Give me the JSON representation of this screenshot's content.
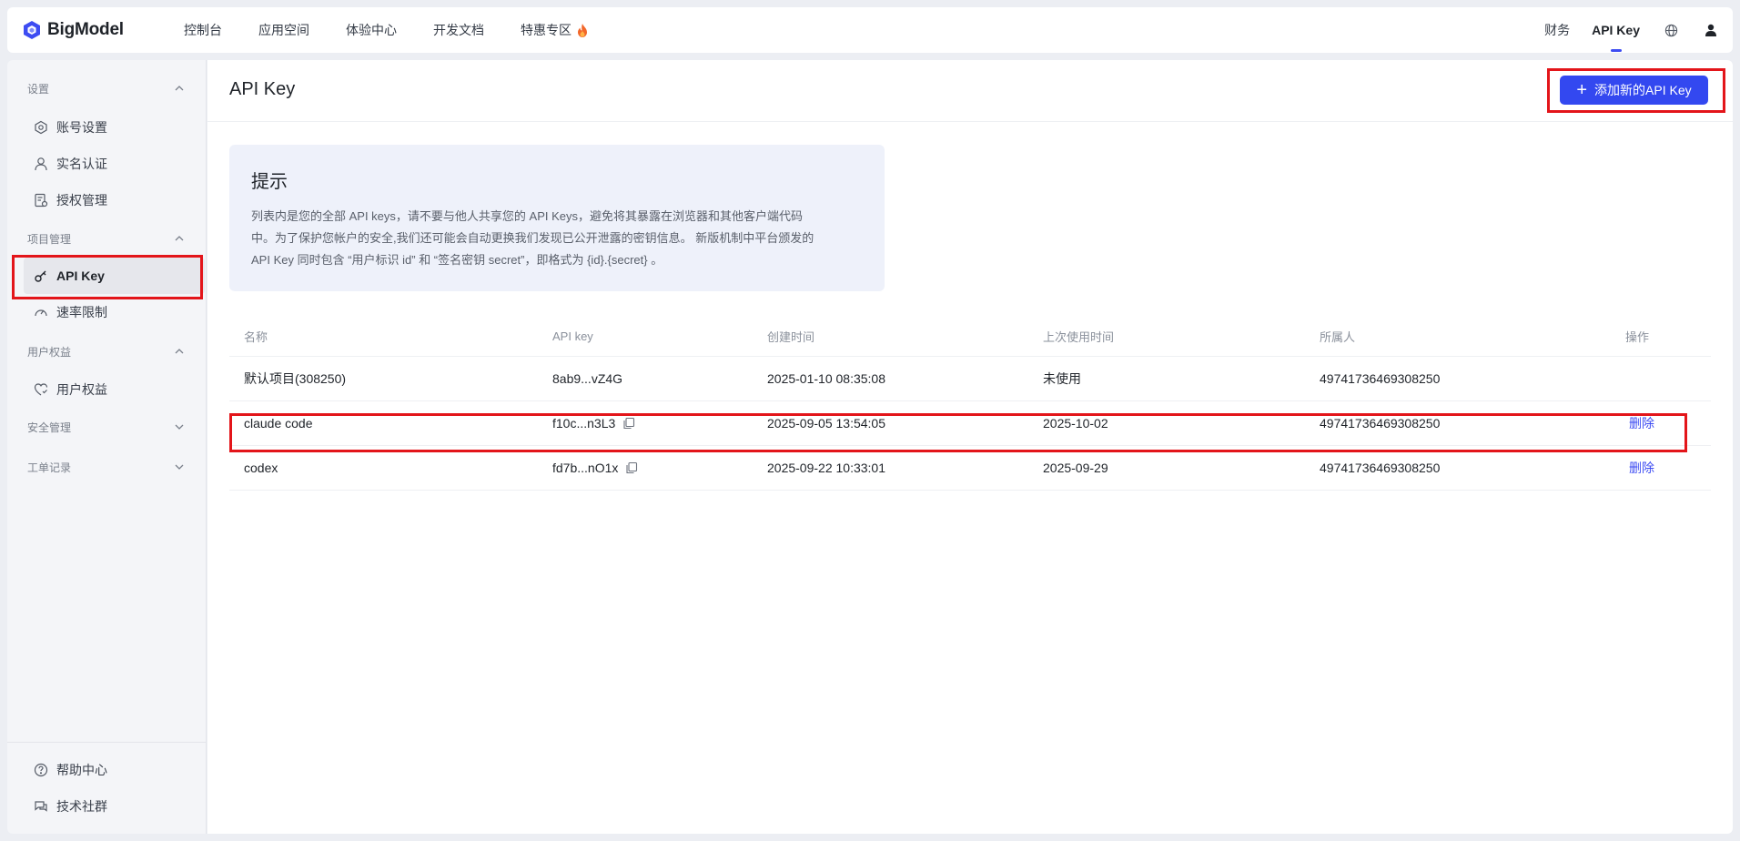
{
  "brand": {
    "name": "BigModel"
  },
  "nav": {
    "items": [
      "控制台",
      "应用空间",
      "体验中心",
      "开发文档",
      "特惠专区"
    ],
    "right": {
      "finance": "财务",
      "api_key": "API Key"
    }
  },
  "sidebar": {
    "groups": {
      "settings": "设置",
      "project": "项目管理",
      "rights": "用户权益",
      "security": "安全管理",
      "tickets": "工单记录"
    },
    "items": {
      "account": "账号设置",
      "realname": "实名认证",
      "auth": "授权管理",
      "apikey": "API Key",
      "ratelimit": "速率限制",
      "userrights": "用户权益",
      "help": "帮助中心",
      "community": "技术社群"
    }
  },
  "main": {
    "title": "API Key",
    "add_button": "添加新的API Key",
    "tip": {
      "title": "提示",
      "line1": "列表内是您的全部 API keys，请不要与他人共享您的 API Keys，避免将其暴露在浏览器和其他客户端代码",
      "line2": "中。为了保护您帐户的安全,我们还可能会自动更换我们发现已公开泄露的密钥信息。 新版机制中平台颁发的",
      "line3": "API Key 同时包含 “用户标识 id” 和 “签名密钥 secret”，即格式为 {id}.{secret} 。"
    },
    "table": {
      "headers": [
        "名称",
        "API key",
        "创建时间",
        "上次使用时间",
        "所属人",
        "操作"
      ],
      "rows": [
        {
          "name": "默认项目(308250)",
          "key": "8ab9...vZ4G",
          "created": "2025-01-10 08:35:08",
          "last_used": "未使用",
          "owner": "49741736469308250",
          "action": ""
        },
        {
          "name": "claude code",
          "key": "f10c...n3L3",
          "created": "2025-09-05 13:54:05",
          "last_used": "2025-10-02",
          "owner": "49741736469308250",
          "action": "删除"
        },
        {
          "name": "codex",
          "key": "fd7b...nO1x",
          "created": "2025-09-22 10:33:01",
          "last_used": "2025-09-29",
          "owner": "49741736469308250",
          "action": "删除"
        }
      ]
    }
  },
  "colors": {
    "accent": "#3348f0",
    "highlight": "#e3151a"
  }
}
